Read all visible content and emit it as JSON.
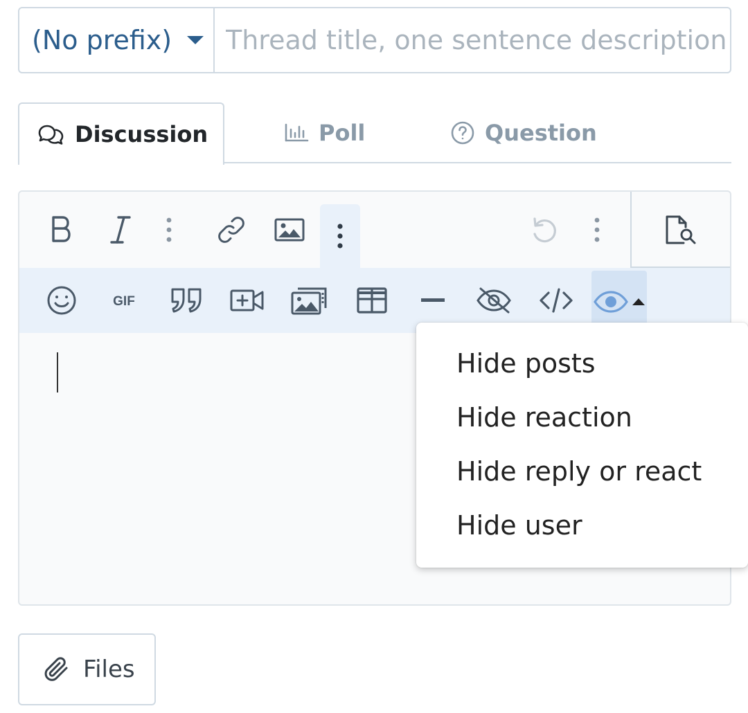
{
  "thread": {
    "prefix_label": "(No prefix)",
    "title_placeholder": "Thread title, one sentence description",
    "title_value": ""
  },
  "tabs": [
    {
      "label": "Discussion",
      "icon": "comments-icon",
      "active": true
    },
    {
      "label": "Poll",
      "icon": "poll-icon",
      "active": false
    },
    {
      "label": "Question",
      "icon": "question-circle-icon",
      "active": false
    }
  ],
  "toolbar": {
    "row1": [
      "bold-icon",
      "italic-icon",
      "more-text-icon",
      "link-icon",
      "image-icon",
      "more-insert-icon",
      "undo-icon",
      "more-misc-icon",
      "preview-icon"
    ],
    "row2": [
      "emoji-icon",
      "gif-icon",
      "quote-icon",
      "video-icon",
      "media-gallery-icon",
      "table-icon",
      "horizontal-rule-icon",
      "spoiler-icon",
      "code-icon",
      "hide-icon"
    ]
  },
  "hide_menu": {
    "items": [
      "Hide posts",
      "Hide reaction",
      "Hide reply or react",
      "Hide user"
    ]
  },
  "attach": {
    "files_label": "Files"
  },
  "colors": {
    "accent": "#2b5d8c",
    "toolbar_active_bg": "#e9f1fa",
    "border": "#cfd9e2",
    "hide_icon": "#6f9fd8"
  }
}
